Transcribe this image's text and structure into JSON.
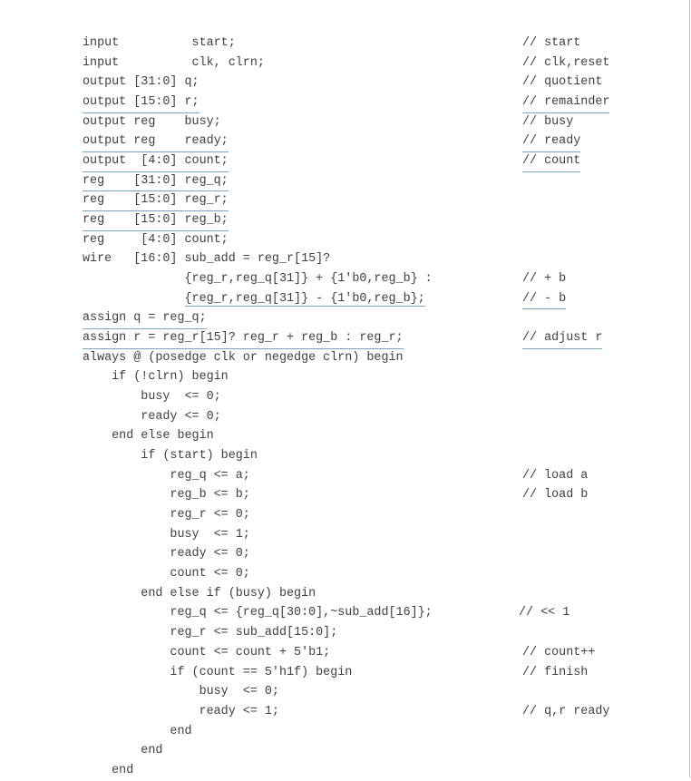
{
  "colors": {
    "text": "#3f3f3f",
    "underline": "#7aa6c6",
    "background": "#ffffff"
  },
  "lines": [
    {
      "code": "input          start;",
      "comment": "// start",
      "code_ul": false,
      "comment_ul": false
    },
    {
      "code": "input          clk, clrn;",
      "comment": "// clk,reset",
      "code_ul": false,
      "comment_ul": false
    },
    {
      "code": "output [31:0] q;",
      "comment": "// quotient",
      "code_ul": false,
      "comment_ul": false
    },
    {
      "code": "output [15:0] r;",
      "comment": "// remainder",
      "code_ul": true,
      "comment_ul": true
    },
    {
      "code": "output reg    busy;",
      "comment": "// busy",
      "code_ul": false,
      "comment_ul": false
    },
    {
      "code": "output reg    ready;",
      "comment": "// ready",
      "code_ul": true,
      "comment_ul": true
    },
    {
      "code": "output  [4:0] count;",
      "comment": "// count",
      "code_ul": true,
      "comment_ul": true
    },
    {
      "code": "reg    [31:0] reg_q;",
      "comment": "",
      "code_ul": true,
      "comment_ul": false
    },
    {
      "code": "reg    [15:0] reg_r;",
      "comment": "",
      "code_ul": true,
      "comment_ul": false
    },
    {
      "code": "reg    [15:0] reg_b;",
      "comment": "",
      "code_ul": true,
      "comment_ul": false
    },
    {
      "code": "reg     [4:0] count;",
      "comment": "",
      "code_ul": false,
      "comment_ul": false
    },
    {
      "code": "wire   [16:0] sub_add = reg_r[15]?",
      "comment": "",
      "code_ul": false,
      "comment_ul": false
    },
    {
      "code": "              {reg_r,reg_q[31]} + {1'b0,reg_b} :",
      "comment": "// + b",
      "code_ul": false,
      "comment_ul": false
    },
    {
      "code": "              {reg_r,reg_q[31]} - {1'b0,reg_b};",
      "comment": "// - b",
      "code_ul": true,
      "comment_ul": true,
      "ul_indent": 14
    },
    {
      "code": "assign q = reg_q;",
      "comment": "",
      "code_ul": true,
      "comment_ul": false
    },
    {
      "code": "assign r = reg_r[15]? reg_r + reg_b : reg_r;",
      "comment": "// adjust r",
      "code_ul": true,
      "comment_ul": true
    },
    {
      "code": "always @ (posedge clk or negedge clrn) begin",
      "comment": "",
      "code_ul": false,
      "comment_ul": false
    },
    {
      "code": "    if (!clrn) begin",
      "comment": "",
      "code_ul": false,
      "comment_ul": false
    },
    {
      "code": "        busy  <= 0;",
      "comment": "",
      "code_ul": false,
      "comment_ul": false
    },
    {
      "code": "        ready <= 0;",
      "comment": "",
      "code_ul": false,
      "comment_ul": false
    },
    {
      "code": "    end else begin",
      "comment": "",
      "code_ul": false,
      "comment_ul": false
    },
    {
      "code": "        if (start) begin",
      "comment": "",
      "code_ul": false,
      "comment_ul": false
    },
    {
      "code": "            reg_q <= a;",
      "comment": "// load a",
      "code_ul": false,
      "comment_ul": false
    },
    {
      "code": "            reg_b <= b;",
      "comment": "// load b",
      "code_ul": false,
      "comment_ul": false
    },
    {
      "code": "            reg_r <= 0;",
      "comment": "",
      "code_ul": false,
      "comment_ul": false
    },
    {
      "code": "            busy  <= 1;",
      "comment": "",
      "code_ul": false,
      "comment_ul": false
    },
    {
      "code": "            ready <= 0;",
      "comment": "",
      "code_ul": false,
      "comment_ul": false
    },
    {
      "code": "            count <= 0;",
      "comment": "",
      "code_ul": false,
      "comment_ul": false
    },
    {
      "code": "        end else if (busy) begin",
      "comment": "",
      "code_ul": false,
      "comment_ul": false
    },
    {
      "code": "            reg_q <= {reg_q[30:0],~sub_add[16]};",
      "comment": "// << 1",
      "code_ul": false,
      "comment_ul": false,
      "comment_shift": -4
    },
    {
      "code": "            reg_r <= sub_add[15:0];",
      "comment": "",
      "code_ul": false,
      "comment_ul": false
    },
    {
      "code": "            count <= count + 5'b1;",
      "comment": "// count++",
      "code_ul": false,
      "comment_ul": false
    },
    {
      "code": "            if (count == 5'h1f) begin",
      "comment": "// finish",
      "code_ul": false,
      "comment_ul": false
    },
    {
      "code": "                busy  <= 0;",
      "comment": "",
      "code_ul": false,
      "comment_ul": false
    },
    {
      "code": "                ready <= 1;",
      "comment": "// q,r ready",
      "code_ul": false,
      "comment_ul": false
    },
    {
      "code": "            end",
      "comment": "",
      "code_ul": false,
      "comment_ul": false
    },
    {
      "code": "        end",
      "comment": "",
      "code_ul": false,
      "comment_ul": false
    },
    {
      "code": "    end",
      "comment": "",
      "code_ul": false,
      "comment_ul": false
    }
  ]
}
